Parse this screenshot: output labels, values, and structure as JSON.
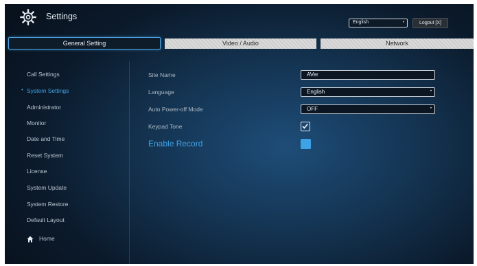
{
  "header": {
    "title": "Settings",
    "language_value": "English",
    "logout_label": "Logout [X]"
  },
  "tabs": [
    {
      "label": "General Setting",
      "active": true
    },
    {
      "label": "Video / Audio",
      "active": false
    },
    {
      "label": "Network",
      "active": false
    }
  ],
  "sidebar": {
    "items": [
      {
        "label": "Call Settings"
      },
      {
        "label": "System Settings",
        "active": true
      },
      {
        "label": "Administrator"
      },
      {
        "label": "Monitor"
      },
      {
        "label": "Date and Time"
      },
      {
        "label": "Reset System"
      },
      {
        "label": "License"
      },
      {
        "label": "System Update"
      },
      {
        "label": "System Restore"
      },
      {
        "label": "Default Layout"
      }
    ],
    "home_label": "Home",
    "active_bullet": "•"
  },
  "form": {
    "site_name_label": "Site Name",
    "site_name_value": "AVer",
    "language_label": "Language",
    "language_value": "English",
    "auto_power_off_label": "Auto Power-off Mode",
    "auto_power_off_value": "OFF",
    "keypad_tone_label": "Keypad Tone",
    "keypad_tone_checked": true,
    "enable_record_label": "Enable Record",
    "enable_record_on": true
  },
  "glyphs": {
    "dropdown_arrow": "•"
  },
  "colors": {
    "accent": "#3ea2e6",
    "tab_inactive": "#d4d4d4"
  }
}
